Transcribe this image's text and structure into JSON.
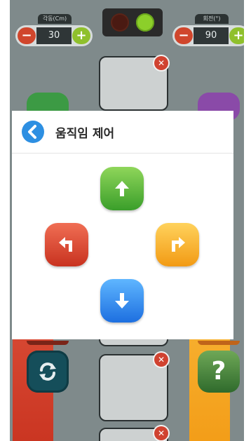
{
  "top_controls": {
    "left_stepper": {
      "caption": "각동(Cm)",
      "value": "30",
      "minus": "−",
      "plus": "+"
    },
    "right_stepper": {
      "caption": "회전(°)",
      "value": "90",
      "minus": "−",
      "plus": "+"
    },
    "traffic_light": {
      "red": "off",
      "green": "on"
    }
  },
  "background": {
    "help_label": "?",
    "close_symbol": "✕"
  },
  "dialog": {
    "title": "움직임 제어",
    "buttons": [
      "up",
      "left",
      "right",
      "down"
    ]
  },
  "colors": {
    "up": "#4caf35",
    "left": "#e0452c",
    "right": "#f7b22b",
    "down": "#2f86ef",
    "back": "#2d8fe2"
  }
}
